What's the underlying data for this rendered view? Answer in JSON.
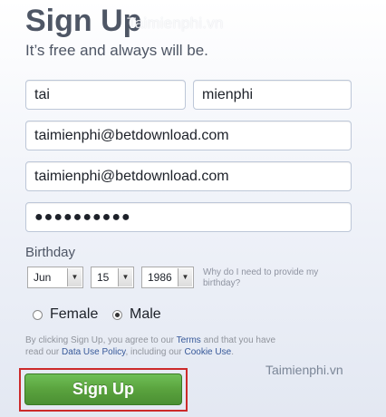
{
  "form": {
    "title": "Sign Up",
    "subtitle": "It’s free and always will be.",
    "first_name": "tai",
    "last_name": "mienphi",
    "email": "taimienphi@betdownload.com",
    "email_confirm": "taimienphi@betdownload.com",
    "password_masked": "●●●●●●●●●●",
    "birthday_label": "Birthday",
    "birthday": {
      "month": "Jun",
      "day": "15",
      "year": "1986"
    },
    "why_birthday": "Why do I need to provide my birthday?",
    "gender": {
      "female_label": "Female",
      "male_label": "Male",
      "selected": "male"
    },
    "terms": {
      "text_1": "By clicking Sign Up, you agree to our ",
      "terms_link": "Terms",
      "text_2": " and that you have read our ",
      "data_policy_link": "Data Use Policy",
      "text_3": ", including our ",
      "cookie_link": "Cookie Use",
      "text_4": "."
    },
    "submit_label": "Sign Up"
  },
  "watermark": {
    "top": "Taimienphi.vn",
    "bottom": "Taimienphi.vn"
  },
  "colors": {
    "button_green": "#5aa33e",
    "highlight_red": "#cc2a2a",
    "link_blue": "#365899"
  }
}
